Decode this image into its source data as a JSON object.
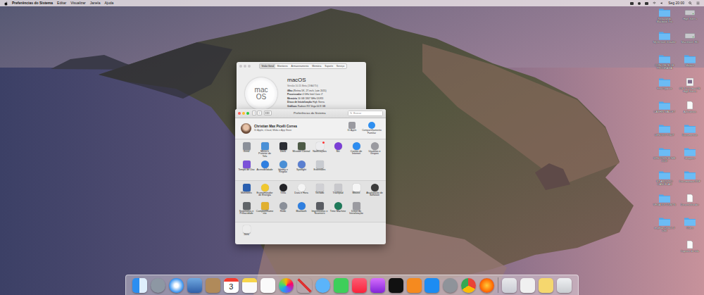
{
  "menu_bar": {
    "app": "Preferências do Sistema",
    "items": [
      "Editar",
      "Visualizar",
      "Janela",
      "Ajuda"
    ],
    "clock": "Seg 20:00"
  },
  "about_window": {
    "active": false,
    "tabs": [
      {
        "label": "Visão Geral",
        "selected": true
      },
      {
        "label": "Monitores",
        "selected": false
      },
      {
        "label": "Armazenamento",
        "selected": false
      },
      {
        "label": "Memória",
        "selected": false
      },
      {
        "label": "Suporte",
        "selected": false
      },
      {
        "label": "Serviço",
        "selected": false
      }
    ],
    "logo": [
      "mac",
      "OS"
    ],
    "title": "macOS",
    "version": "Versão 10.15 Beta (19A471t)",
    "specs": [
      {
        "label": "iMac",
        "value": "(Retina 5K, 27-inch, Late 2015)"
      },
      {
        "label": "Processador",
        "value": "4 GHz Intel Core i7"
      },
      {
        "label": "Memória",
        "value": "16 GB 1867 MHz DDR3"
      },
      {
        "label": "Disco de Inicialização",
        "value": "High Sierra"
      },
      {
        "label": "Gráficos",
        "value": "Radeon RX Vega 64 8 GB"
      }
    ]
  },
  "prefs_window": {
    "active": true,
    "title": "Preferências do Sistema",
    "nav": [
      "‹",
      "›"
    ],
    "search": {
      "placeholder": "Buscar"
    },
    "user": {
      "name": "Christian Max Picelli Correa",
      "subtitle": "ID Apple, iCloud, Mídia e App Store"
    },
    "account_items": [
      {
        "label": "ID Apple"
      },
      {
        "label": "Compartilhamento Familiar"
      }
    ],
    "sections": [
      {
        "items": [
          {
            "label": "Geral"
          },
          {
            "label": "Mesa e Protetor de Tela"
          },
          {
            "label": "Dock"
          },
          {
            "label": "Mission Control"
          },
          {
            "label": "Notificações"
          },
          {
            "label": "Siri"
          },
          {
            "label": "Contas de Internet"
          },
          {
            "label": "Usuários e Grupos"
          },
          {
            "label": "Tempo de Uso"
          },
          {
            "label": "Acessibilidade"
          },
          {
            "label": "Idioma e Região"
          },
          {
            "label": "Spotlight"
          },
          {
            "label": "Extensões"
          }
        ]
      },
      {
        "items": [
          {
            "label": "Monitores"
          },
          {
            "label": "Economizador de Energia"
          },
          {
            "label": "Tinta"
          },
          {
            "label": "Data e Hora"
          },
          {
            "label": "Teclado"
          },
          {
            "label": "Trackpad"
          },
          {
            "label": "Mouse"
          },
          {
            "label": "Atualização de Software"
          },
          {
            "label": "Segurança e Privacidade"
          },
          {
            "label": "Compartilhamento"
          },
          {
            "label": "Rede"
          },
          {
            "label": "Bluetooth"
          },
          {
            "label": "Impressoras e Scanners"
          },
          {
            "label": "Time Machine"
          },
          {
            "label": "Disco de Inicialização"
          }
        ]
      },
      {
        "items": [
          {
            "label": "Java"
          }
        ]
      }
    ]
  },
  "desktop_icons": {
    "columns": [
      [
        {
          "label": "Reparando Macbook Pro",
          "kind": "folder"
        },
        {
          "label": "MyVersion Installer",
          "kind": "folder"
        },
        {
          "label": "CONCRETE DE PROGRAMA",
          "kind": "folder"
        },
        {
          "label": "Final Update",
          "kind": "folder"
        },
        {
          "label": "CASHIN WALLET",
          "kind": "folder"
        },
        {
          "label": "LENOVO T740T",
          "kind": "folder"
        },
        {
          "label": "WINDOWS HOME 2019",
          "kind": "folder"
        },
        {
          "label": "ST ARQUIVO CANCELAR",
          "kind": "folder"
        },
        {
          "label": "VEGA RX 570MTS",
          "kind": "folder"
        },
        {
          "label": "imgMac Unlock 2 Dell",
          "kind": "folder"
        }
      ],
      [
        {
          "label": "High Sierra",
          "kind": "disk"
        },
        {
          "label": "Macintosh HD",
          "kind": "disk"
        },
        {
          "label": "Mojave",
          "kind": "folder"
        },
        {
          "label": "OS 10.15 macOS High Sierra",
          "kind": "image"
        },
        {
          "label": "Aplicativos",
          "kind": "file"
        },
        {
          "label": "Documentos",
          "kind": "folder"
        },
        {
          "label": "Imagens",
          "kind": "folder"
        },
        {
          "label": "Documentos PDF",
          "kind": "folder"
        },
        {
          "label": "Desenvolvedor",
          "kind": "file"
        },
        {
          "label": "Outro",
          "kind": "folder"
        },
        {
          "label": "Captura de tela",
          "kind": "file"
        }
      ]
    ]
  },
  "dock": {
    "calendar_day": "3"
  }
}
